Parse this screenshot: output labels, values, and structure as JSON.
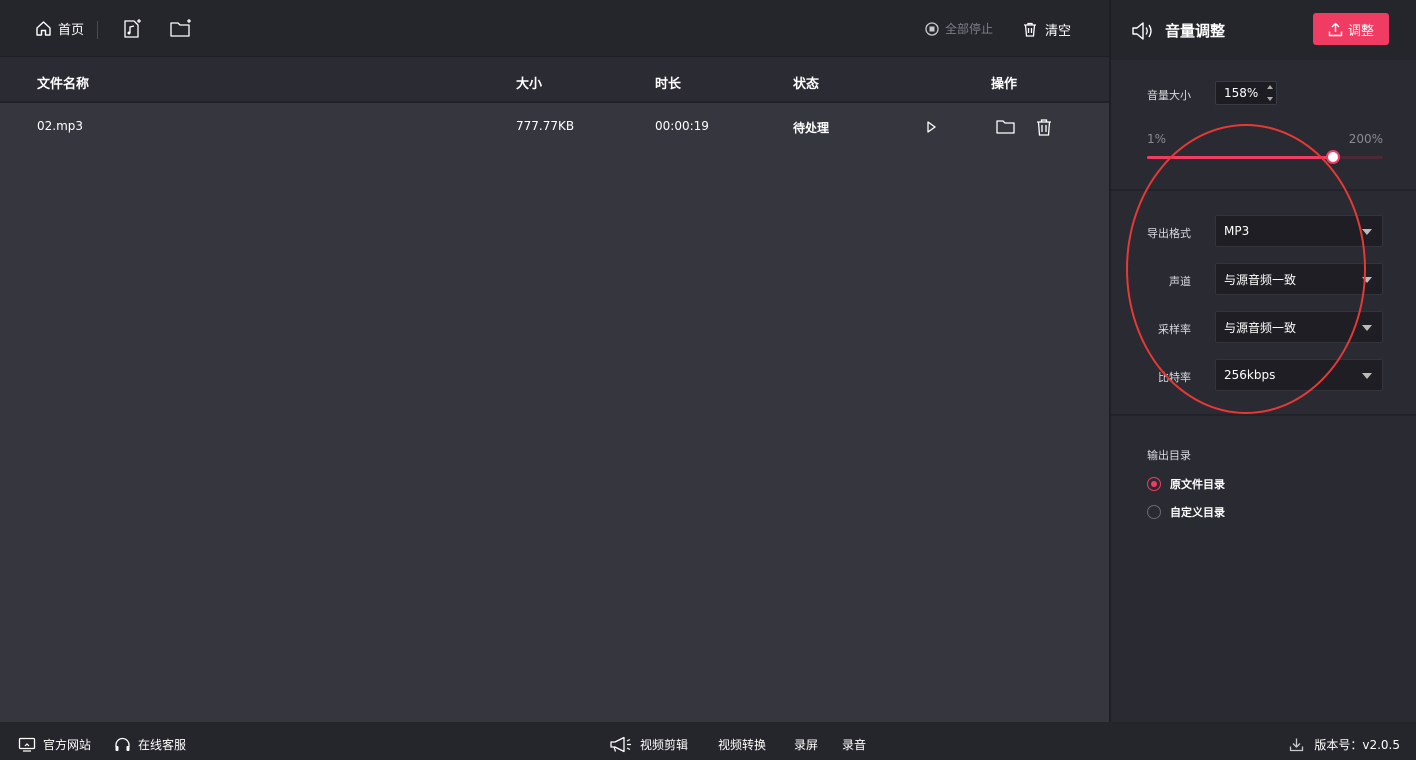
{
  "toolbar": {
    "home_label": "首页",
    "stop_all_label": "全部停止",
    "clear_label": "清空"
  },
  "table": {
    "headers": [
      "文件名称",
      "大小",
      "时长",
      "状态",
      "操作"
    ],
    "rows": [
      {
        "name": "02.mp3",
        "size": "777.77KB",
        "duration": "00:00:19",
        "status": "待处理"
      }
    ]
  },
  "panel": {
    "title": "音量调整",
    "apply_button": "调整",
    "volume": {
      "label": "音量大小",
      "value": "158%",
      "min_label": "1%",
      "max_label": "200%",
      "min": 1,
      "max": 200,
      "current": 158
    },
    "fields": [
      {
        "label": "导出格式",
        "value": "MP3"
      },
      {
        "label": "声道",
        "value": "与源音频一致"
      },
      {
        "label": "采样率",
        "value": "与源音频一致"
      },
      {
        "label": "比特率",
        "value": "256kbps"
      }
    ],
    "output": {
      "label": "输出目录",
      "options": [
        {
          "label": "原文件目录",
          "selected": true
        },
        {
          "label": "自定义目录",
          "selected": false
        }
      ]
    }
  },
  "footer": {
    "website": "官方网站",
    "support": "在线客服",
    "video_edit": "视频剪辑",
    "video_convert": "视频转换",
    "screen_record": "录屏",
    "audio_record": "录音",
    "version": "版本号：v2.0.5"
  },
  "colors": {
    "accent": "#f03c62",
    "annotation": "#e53935"
  }
}
